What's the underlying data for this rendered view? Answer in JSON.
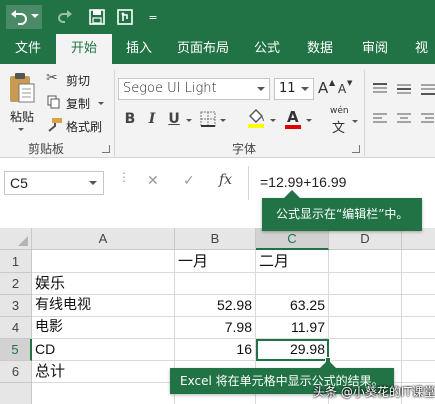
{
  "quick_access": {
    "more": "="
  },
  "tabs": [
    "文件",
    "开始",
    "插入",
    "页面布局",
    "公式",
    "数据",
    "审阅",
    "视"
  ],
  "ribbon": {
    "paste_label": "粘贴",
    "cut_label": "剪切",
    "copy_label": "复制",
    "format_painter_label": "格式刷",
    "clipboard_group": "剪贴板",
    "font_name": "Segoe UI Light",
    "font_size": "11",
    "grow_font": "A",
    "shrink_font": "A",
    "bold": "B",
    "italic": "I",
    "underline": "U",
    "font_color": "A",
    "phonetic": "wén",
    "phonetic_base": "文",
    "font_group": "字体"
  },
  "formula_bar": {
    "name_box": "C5",
    "cancel": "✕",
    "enter": "✓",
    "fx": "fx",
    "formula": "=12.99+16.99"
  },
  "callouts": {
    "formula": "公式显示在“编辑栏”中。",
    "cell": "Excel 将在单元格中显示公式的结果。"
  },
  "columns": [
    "A",
    "B",
    "C",
    "D"
  ],
  "rows": [
    "1",
    "2",
    "3",
    "4",
    "5",
    "6"
  ],
  "cells": {
    "b1": "一月",
    "c1": "二月",
    "a2": "娱乐",
    "a3": "有线电视",
    "b3": "52.98",
    "c3": "63.25",
    "a4": "电影",
    "b4": "7.98",
    "c4": "11.97",
    "a5": "CD",
    "b5": "16",
    "c5": "29.98",
    "a6": "总计"
  },
  "selected_cell": "C5",
  "watermark": "头条 @小葵花的IT课堂",
  "colors": {
    "accent": "#217346",
    "ribbon_bg": "#f3f3f3",
    "header_bg": "#e6e6e6"
  }
}
